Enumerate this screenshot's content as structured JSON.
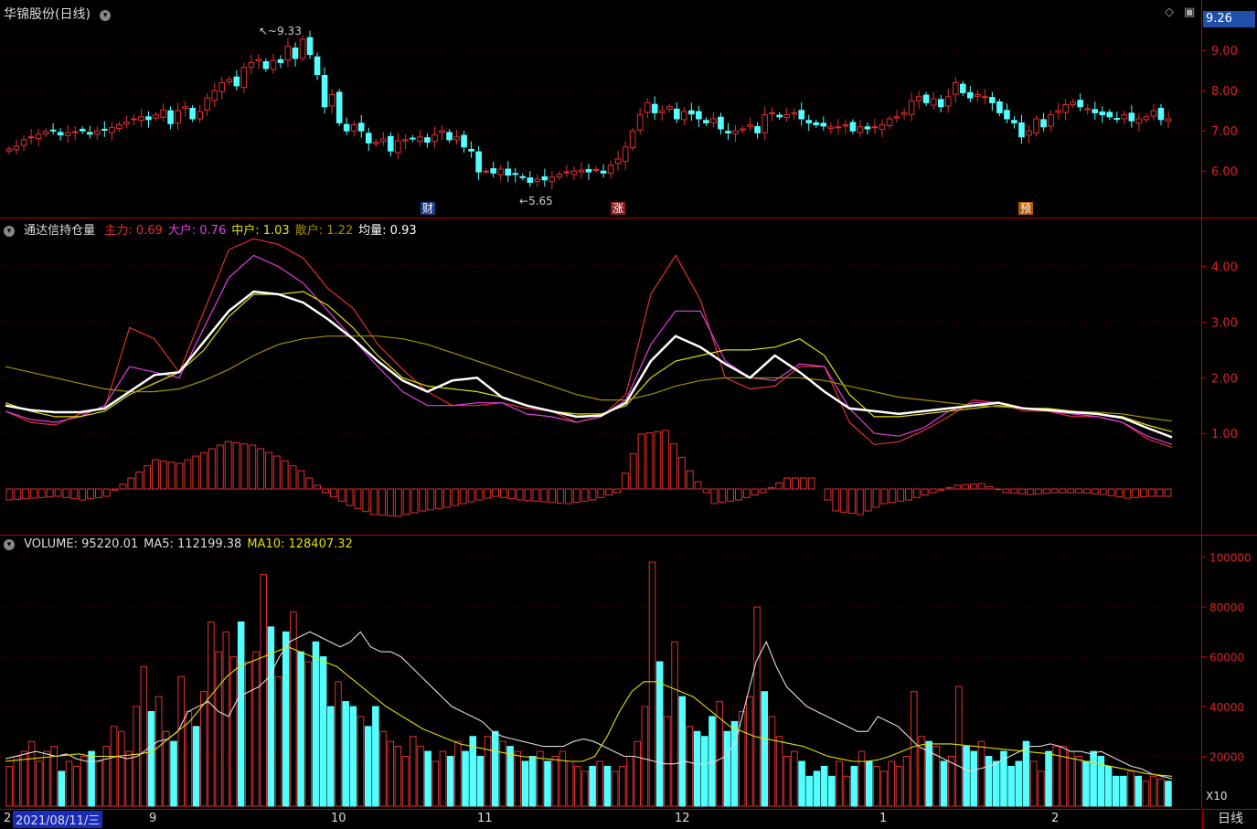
{
  "stock": {
    "title": "华锦股份(日线)",
    "current_price_tag": "9.26",
    "high_marker": "9.33",
    "low_marker": "5.65",
    "tags": [
      "财",
      "涨",
      "预"
    ]
  },
  "indicator": {
    "name": "通达信持仓量",
    "legend": [
      {
        "label": "主力:",
        "value": "0.69",
        "color": "#e03030"
      },
      {
        "label": "大户:",
        "value": "0.76",
        "color": "#e040e0"
      },
      {
        "label": "中户:",
        "value": "1.03",
        "color": "#e0e000"
      },
      {
        "label": "散户:",
        "value": "1.22",
        "color": "#a09000"
      },
      {
        "label": "均量:",
        "value": "0.93",
        "color": "#ffffff"
      }
    ]
  },
  "volume": {
    "legend": [
      {
        "label": "VOLUME:",
        "value": "95220.01",
        "color": "#dddddd"
      },
      {
        "label": "MA5:",
        "value": "112199.38",
        "color": "#dddddd"
      },
      {
        "label": "MA10:",
        "value": "128407.32",
        "color": "#e0e000"
      }
    ],
    "multiplier": "X10"
  },
  "dates": {
    "selected": "2021/08/11/三",
    "left_stub": "2",
    "ticks": [
      "9",
      "10",
      "11",
      "12",
      "1",
      "2"
    ],
    "period_tab": "日线"
  },
  "chart_data": [
    {
      "type": "candlestick",
      "title": "华锦股份(日线)",
      "y_ticks": [
        "9.00",
        "8.00",
        "7.00",
        "6.00"
      ],
      "ylim": [
        5.3,
        9.8
      ],
      "close": [
        6.55,
        6.62,
        6.78,
        6.85,
        6.92,
        6.98,
        7.02,
        6.9,
        6.95,
        6.98,
        7.0,
        6.92,
        7.0,
        7.02,
        7.08,
        7.15,
        7.22,
        7.3,
        7.35,
        7.28,
        7.4,
        7.52,
        7.18,
        7.5,
        7.6,
        7.3,
        7.48,
        7.82,
        8.0,
        8.2,
        8.28,
        8.12,
        8.58,
        8.7,
        8.78,
        8.55,
        8.75,
        8.7,
        9.1,
        8.8,
        9.28,
        8.9,
        8.4,
        7.6,
        7.9,
        7.2,
        7.0,
        7.15,
        7.0,
        6.7,
        6.72,
        6.8,
        6.5,
        6.75,
        6.78,
        6.8,
        6.85,
        6.72,
        6.9,
        7.0,
        6.78,
        6.85,
        6.6,
        6.5,
        5.98,
        6.0,
        5.95,
        6.05,
        5.9,
        5.92,
        5.85,
        5.72,
        5.8,
        5.78,
        5.85,
        5.92,
        5.98,
        6.0,
        6.02,
        5.98,
        6.04,
        5.95,
        6.15,
        6.3,
        6.6,
        7.0,
        7.4,
        7.7,
        7.45,
        7.5,
        7.6,
        7.3,
        7.48,
        7.42,
        7.3,
        7.2,
        7.3,
        7.05,
        6.95,
        7.0,
        7.05,
        7.15,
        6.95,
        7.4,
        7.45,
        7.35,
        7.4,
        7.45,
        7.3,
        7.2,
        7.15,
        7.12,
        7.1,
        7.1,
        7.15,
        7.0,
        7.1,
        7.05,
        7.1,
        7.15,
        7.3,
        7.35,
        7.45,
        7.75,
        7.85,
        7.7,
        7.8,
        7.6,
        7.85,
        8.2,
        7.95,
        7.82,
        7.9,
        7.85,
        7.7,
        7.45,
        7.3,
        7.2,
        6.85,
        7.0,
        7.3,
        7.1,
        7.4,
        7.5,
        7.65,
        7.72,
        7.6,
        7.55,
        7.45,
        7.4,
        7.35,
        7.3,
        7.4,
        7.25,
        7.3,
        7.35,
        7.5,
        7.28,
        7.3
      ],
      "annotations": {
        "high": "9.33",
        "low": "5.65"
      }
    },
    {
      "type": "line",
      "title": "通达信持仓量",
      "y_ticks": [
        "4.00",
        "3.00",
        "2.00",
        "1.00"
      ],
      "ylim": [
        0,
        4.7
      ],
      "series": [
        {
          "name": "主力",
          "color": "#e03030",
          "values": [
            1.4,
            1.2,
            1.15,
            1.35,
            1.45,
            2.9,
            2.7,
            2.1,
            3.2,
            4.3,
            4.5,
            4.4,
            4.15,
            3.6,
            3.25,
            2.6,
            2.15,
            1.75,
            1.5,
            1.5,
            1.55,
            1.45,
            1.4,
            1.2,
            1.3,
            1.7,
            3.5,
            4.2,
            3.4,
            2.0,
            1.8,
            1.85,
            2.2,
            2.2,
            1.2,
            0.8,
            0.85,
            1.05,
            1.3,
            1.6,
            1.55,
            1.4,
            1.4,
            1.3,
            1.3,
            1.2,
            0.9,
            0.75
          ]
        },
        {
          "name": "大户",
          "color": "#e040e0",
          "values": [
            1.4,
            1.25,
            1.2,
            1.3,
            1.5,
            2.2,
            2.1,
            2.0,
            2.9,
            3.8,
            4.2,
            4.0,
            3.7,
            3.2,
            2.7,
            2.2,
            1.75,
            1.5,
            1.5,
            1.55,
            1.55,
            1.35,
            1.3,
            1.2,
            1.3,
            1.6,
            2.6,
            3.2,
            3.2,
            2.3,
            2.0,
            1.95,
            2.25,
            2.2,
            1.45,
            1.0,
            0.95,
            1.1,
            1.4,
            1.55,
            1.55,
            1.45,
            1.4,
            1.35,
            1.3,
            1.2,
            0.95,
            0.8
          ]
        },
        {
          "name": "中户",
          "color": "#e0e000",
          "values": [
            1.55,
            1.4,
            1.3,
            1.3,
            1.4,
            1.7,
            1.9,
            2.1,
            2.5,
            3.1,
            3.5,
            3.5,
            3.55,
            3.3,
            2.9,
            2.4,
            2.0,
            1.85,
            1.8,
            1.75,
            1.65,
            1.5,
            1.4,
            1.35,
            1.35,
            1.5,
            2.0,
            2.3,
            2.4,
            2.5,
            2.5,
            2.55,
            2.7,
            2.4,
            1.7,
            1.3,
            1.3,
            1.35,
            1.4,
            1.45,
            1.5,
            1.45,
            1.45,
            1.4,
            1.35,
            1.3,
            1.15,
            1.03
          ]
        },
        {
          "name": "散户",
          "color": "#a09000",
          "values": [
            2.2,
            2.1,
            2.0,
            1.9,
            1.8,
            1.75,
            1.75,
            1.8,
            1.95,
            2.15,
            2.4,
            2.6,
            2.7,
            2.75,
            2.75,
            2.75,
            2.7,
            2.6,
            2.45,
            2.3,
            2.15,
            2.0,
            1.85,
            1.7,
            1.6,
            1.6,
            1.7,
            1.85,
            1.95,
            2.0,
            2.0,
            2.0,
            2.0,
            1.95,
            1.85,
            1.75,
            1.65,
            1.6,
            1.55,
            1.5,
            1.48,
            1.45,
            1.42,
            1.4,
            1.38,
            1.35,
            1.28,
            1.22
          ]
        },
        {
          "name": "均量",
          "color": "#ffffff",
          "values": [
            1.5,
            1.42,
            1.38,
            1.38,
            1.45,
            1.75,
            2.05,
            2.1,
            2.65,
            3.2,
            3.55,
            3.5,
            3.35,
            3.05,
            2.7,
            2.3,
            1.95,
            1.75,
            1.95,
            2.0,
            1.65,
            1.5,
            1.4,
            1.3,
            1.32,
            1.55,
            2.3,
            2.75,
            2.55,
            2.25,
            2.0,
            2.4,
            2.1,
            1.75,
            1.45,
            1.4,
            1.35,
            1.4,
            1.45,
            1.5,
            1.55,
            1.45,
            1.42,
            1.38,
            1.35,
            1.28,
            1.1,
            0.93
          ]
        }
      ],
      "histogram": [
        -0.3,
        -0.25,
        -0.2,
        -0.3,
        -0.2,
        0.3,
        0.8,
        0.7,
        1.0,
        1.3,
        1.2,
        0.9,
        0.5,
        -0.1,
        -0.45,
        -0.7,
        -0.75,
        -0.6,
        -0.5,
        -0.35,
        -0.2,
        -0.3,
        -0.35,
        -0.4,
        -0.3,
        -0.1,
        1.5,
        1.6,
        0.5,
        -0.4,
        -0.3,
        -0.1,
        0.3,
        0.3,
        -0.6,
        -0.7,
        -0.4,
        -0.3,
        -0.1,
        0.1,
        0.15,
        -0.1,
        -0.15,
        -0.1,
        -0.1,
        -0.15,
        -0.25,
        -0.2
      ]
    },
    {
      "type": "bar",
      "title": "VOLUME",
      "y_ticks": [
        "100000",
        "80000",
        "60000",
        "40000",
        "20000"
      ],
      "ylim": [
        0,
        105000
      ],
      "up_color": "#e03030",
      "down_color": "#54ffff",
      "values": [
        16000,
        20000,
        22000,
        26000,
        18000,
        22000,
        24000,
        14000,
        18000,
        16000,
        20000,
        22000,
        18000,
        24000,
        32000,
        30000,
        22000,
        40000,
        56000,
        38000,
        44000,
        30000,
        26000,
        52000,
        38000,
        32000,
        46000,
        74000,
        62000,
        70000,
        60000,
        74000,
        58000,
        62000,
        93000,
        72000,
        52000,
        70000,
        78000,
        62000,
        58000,
        66000,
        60000,
        40000,
        50000,
        42000,
        40000,
        36000,
        32000,
        40000,
        30000,
        26000,
        24000,
        20000,
        28000,
        24000,
        22000,
        18000,
        22000,
        20000,
        26000,
        22000,
        28000,
        20000,
        28000,
        30000,
        26000,
        24000,
        22000,
        18000,
        20000,
        22000,
        18000,
        20000,
        22000,
        18000,
        16000,
        14000,
        16000,
        18000,
        16000,
        14000,
        16000,
        20000,
        26000,
        40000,
        98000,
        58000,
        36000,
        66000,
        44000,
        32000,
        30000,
        28000,
        36000,
        42000,
        30000,
        34000,
        38000,
        44000,
        80000,
        46000,
        36000,
        28000,
        20000,
        22000,
        18000,
        12000,
        14000,
        16000,
        12000,
        18000,
        12000,
        16000,
        22000,
        18000,
        16000,
        14000,
        18000,
        16000,
        20000,
        46000,
        28000,
        26000,
        24000,
        18000,
        20000,
        48000,
        24000,
        22000,
        26000,
        20000,
        18000,
        22000,
        16000,
        18000,
        26000,
        18000,
        14000,
        22000,
        24000,
        24000,
        22000,
        20000,
        18000,
        22000,
        20000,
        16000,
        12000,
        12000,
        14000,
        12000,
        10000,
        12000,
        11000,
        10000
      ],
      "ma5": [
        19000,
        20000,
        21000,
        22000,
        21000,
        20000,
        21000,
        19000,
        18000,
        18000,
        19000,
        20000,
        19000,
        20000,
        23000,
        26000,
        27000,
        30000,
        38000,
        40000,
        42000,
        38000,
        36000,
        44000,
        46000,
        48000,
        52000,
        60000,
        66000,
        68000,
        70000,
        68000,
        66000,
        64000,
        66000,
        70000,
        64000,
        62000,
        62000,
        60000,
        56000,
        52000,
        48000,
        44000,
        40000,
        38000,
        36000,
        34000,
        30000,
        28000,
        27000,
        26000,
        25000,
        24000,
        24000,
        24000,
        26000,
        27000,
        26000,
        24000,
        22000,
        20000,
        20000,
        19000,
        18000,
        17000,
        17000,
        18000,
        17000,
        17000,
        18000,
        20000,
        26000,
        42000,
        58000,
        66000,
        56000,
        48000,
        44000,
        40000,
        38000,
        36000,
        34000,
        32000,
        30000,
        30000,
        36000,
        34000,
        32000,
        28000,
        24000,
        22000,
        20000,
        18000,
        16000,
        14000,
        15000,
        16000,
        18000,
        20000,
        22000,
        24000,
        24000,
        25000,
        24000,
        22000,
        22000,
        21000,
        22000,
        20000,
        18000,
        16000,
        15000,
        13000,
        12000,
        11000
      ],
      "ma10": [
        18000,
        18500,
        19000,
        19500,
        20000,
        20500,
        21000,
        20000,
        20000,
        20000,
        20500,
        21000,
        22000,
        26000,
        30000,
        34000,
        40000,
        46000,
        52000,
        56000,
        58000,
        60000,
        62000,
        64000,
        62000,
        60000,
        58000,
        56000,
        52000,
        48000,
        44000,
        40000,
        37000,
        34000,
        31000,
        29000,
        27000,
        25000,
        24000,
        23000,
        22000,
        21000,
        20000,
        19500,
        19000,
        18500,
        18000,
        18000,
        20000,
        28000,
        38000,
        46000,
        50000,
        50000,
        48000,
        46000,
        44000,
        40000,
        36000,
        32000,
        30000,
        28000,
        27000,
        26000,
        25000,
        24000,
        22000,
        20000,
        19000,
        18000,
        18000,
        18500,
        20000,
        22000,
        24000,
        25000,
        25000,
        25000,
        24500,
        24000,
        23500,
        23000,
        22500,
        22000,
        21500,
        21000,
        20000,
        19000,
        18000,
        17000,
        16000,
        15000,
        14000,
        13000,
        12500,
        12000
      ]
    }
  ]
}
